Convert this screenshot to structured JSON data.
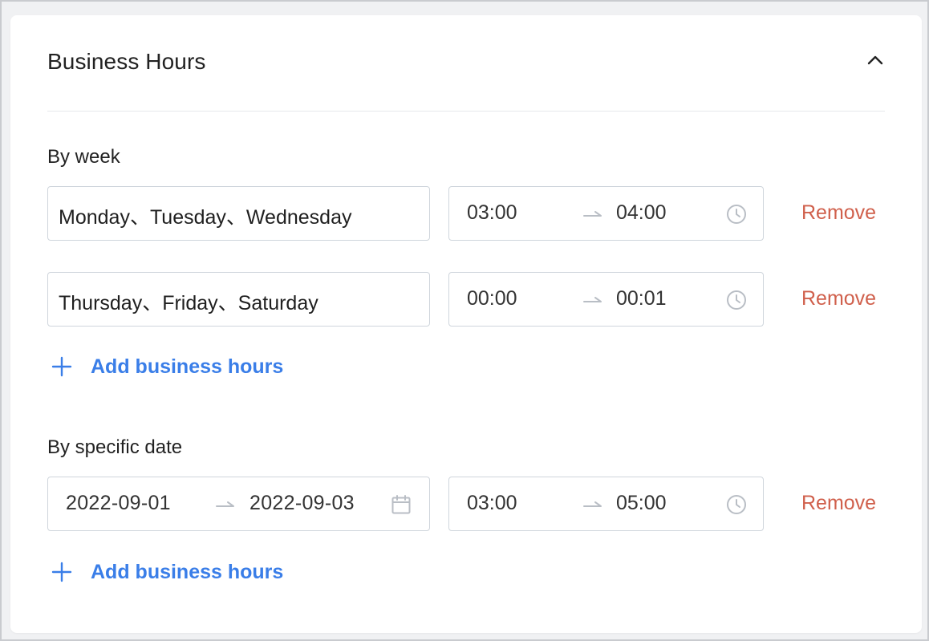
{
  "card": {
    "title": "Business Hours"
  },
  "by_week": {
    "label": "By week",
    "rows": [
      {
        "days": "Monday、Tuesday、Wednesday",
        "start": "03:00",
        "end": "04:00",
        "remove_label": "Remove"
      },
      {
        "days": "Thursday、Friday、Saturday",
        "start": "00:00",
        "end": "00:01",
        "remove_label": "Remove"
      }
    ],
    "add_label": "Add business hours"
  },
  "by_date": {
    "label": "By specific date",
    "rows": [
      {
        "date_start": "2022-09-01",
        "date_end": "2022-09-03",
        "start": "03:00",
        "end": "05:00",
        "remove_label": "Remove"
      }
    ],
    "add_label": "Add business hours"
  },
  "icons": {
    "collapse": "chevron-up-icon",
    "range_arrow": "right-arrow-icon",
    "clock": "clock-icon",
    "calendar": "calendar-icon",
    "add": "plus-icon"
  },
  "colors": {
    "remove": "#d0604c",
    "link": "#3a7ee8",
    "border": "#cfd5dc"
  }
}
